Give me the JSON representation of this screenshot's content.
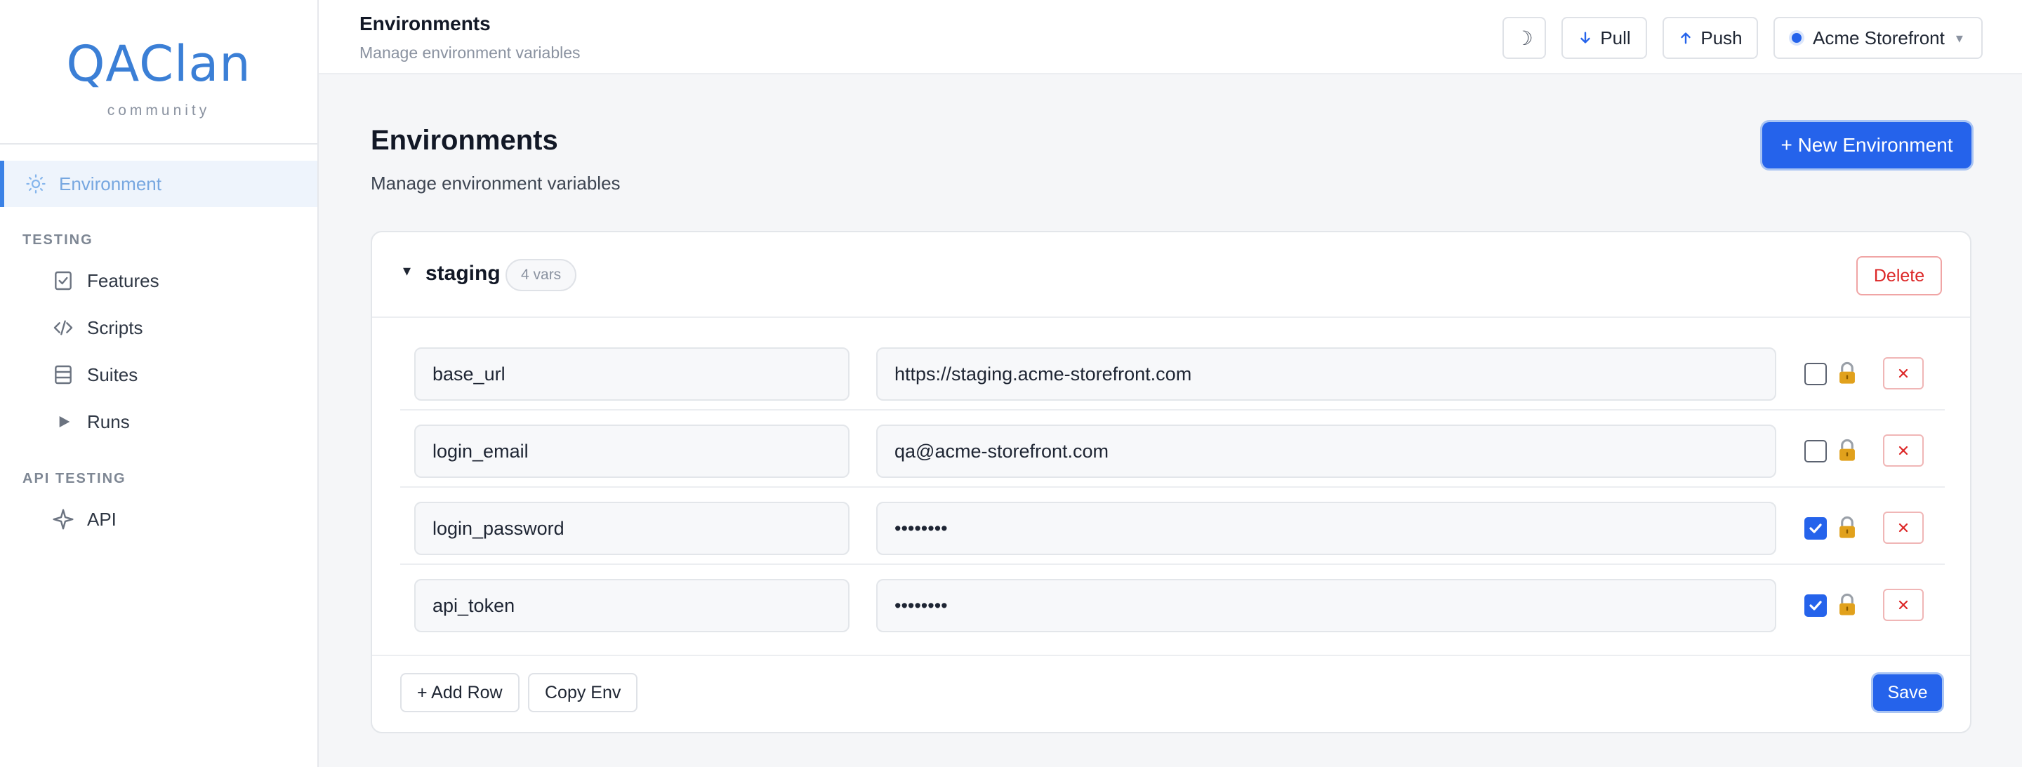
{
  "brand": {
    "logo": "QAClan",
    "logo_first": "Q",
    "logo_rest": "AClan",
    "tagline": "community"
  },
  "sidebar": {
    "active_item": {
      "label": "Environment",
      "icon": "sun-icon"
    },
    "sections": [
      {
        "title": "TESTING",
        "items": [
          {
            "label": "Features",
            "icon": "checklist-icon"
          },
          {
            "label": "Scripts",
            "icon": "code-icon"
          },
          {
            "label": "Suites",
            "icon": "stack-icon"
          },
          {
            "label": "Runs",
            "icon": "play-icon"
          }
        ]
      },
      {
        "title": "API TESTING",
        "items": [
          {
            "label": "API",
            "icon": "sparkle-icon"
          }
        ]
      }
    ]
  },
  "header": {
    "title": "Environments",
    "subtitle": "Manage environment variables",
    "theme_icon": "☽",
    "pull_label": "Pull",
    "push_label": "Push",
    "project_label": "Acme Storefront",
    "project_caret": "▾"
  },
  "main": {
    "title": "Environments",
    "subtitle": "Manage environment variables",
    "new_env_label": "+ New Environment"
  },
  "env": {
    "caret": "▾",
    "name": "staging",
    "count_label": "4 vars",
    "delete_label": "Delete",
    "rows": [
      {
        "key": "base_url",
        "value": "https://staging.acme-storefront.com",
        "secret": false
      },
      {
        "key": "login_email",
        "value": "qa@acme-storefront.com",
        "secret": false
      },
      {
        "key": "login_password",
        "value": "••••••••",
        "secret": true
      },
      {
        "key": "api_token",
        "value": "••••••••",
        "secret": true
      }
    ],
    "add_row_label": "+ Add Row",
    "copy_label": "Copy Env",
    "save_label": "Save"
  },
  "colors": {
    "accent": "#2563eb",
    "active_bg": "#eef4fc",
    "danger": "#dc2626",
    "lock": "#d4a017"
  }
}
